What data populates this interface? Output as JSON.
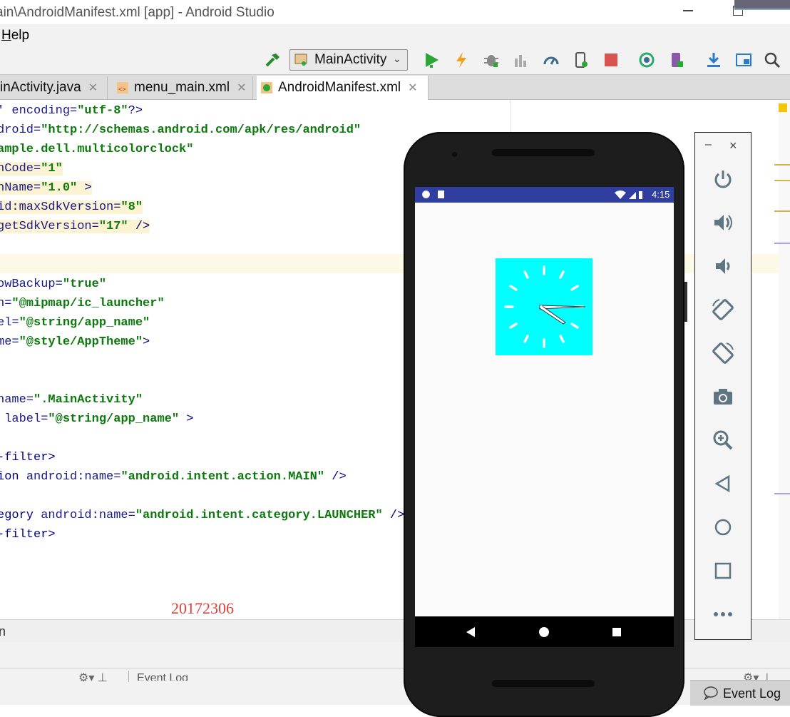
{
  "window": {
    "title": "ain\\AndroidManifest.xml [app] - Android Studio"
  },
  "menu": {
    "help": "Help"
  },
  "toolbar": {
    "run_config": "MainActivity",
    "icons": [
      "hammer-icon",
      "run-icon",
      "apply-changes-icon",
      "debug-icon",
      "profile-icon",
      "attach-debugger-icon",
      "device-file-icon",
      "stop-icon",
      "sync-icon",
      "avd-manager-icon",
      "sdk-manager-icon",
      "project-structure-icon",
      "search-icon"
    ]
  },
  "tabs": [
    {
      "label": "inActivity.java"
    },
    {
      "label": "menu_main.xml"
    },
    {
      "label": "AndroidManifest.xml"
    }
  ],
  "code": [
    {
      "parts": [
        [
          "attr",
          "' encoding="
        ],
        [
          "str",
          "\"utf-8\""
        ],
        [
          "tag",
          "?>"
        ]
      ]
    },
    {
      "parts": [
        [
          "attr",
          "droid="
        ],
        [
          "str",
          "\"http://schemas.android.com/apk/res/android\""
        ]
      ]
    },
    {
      "parts": [
        [
          "str",
          "ample.dell.multicolorclock\""
        ]
      ]
    },
    {
      "parts": [
        [
          "attr",
          "nCode="
        ],
        [
          "str",
          "\"1\""
        ]
      ],
      "hl": true
    },
    {
      "parts": [
        [
          "attr",
          "nName="
        ],
        [
          "str",
          "\"1.0\""
        ],
        [
          "tag",
          " >"
        ]
      ],
      "hl": true
    },
    {
      "parts": [
        [
          "attr",
          "id:maxSdkVersion="
        ],
        [
          "str",
          "\"8\""
        ]
      ],
      "hl": true
    },
    {
      "parts": [
        [
          "attr",
          "getSdkVersion="
        ],
        [
          "str",
          "\"17\""
        ],
        [
          "tag",
          " />"
        ]
      ],
      "hl": true
    },
    {
      "parts": [
        [
          "tag",
          ""
        ]
      ]
    },
    {
      "parts": [
        [
          "tag",
          ""
        ]
      ]
    },
    {
      "parts": [
        [
          "attr",
          "owBackup="
        ],
        [
          "str",
          "\"true\""
        ]
      ]
    },
    {
      "parts": [
        [
          "attr",
          "n="
        ],
        [
          "str",
          "\"@mipmap/ic_launcher\""
        ]
      ]
    },
    {
      "parts": [
        [
          "attr",
          "el="
        ],
        [
          "str",
          "\"@string/app_name\""
        ]
      ]
    },
    {
      "parts": [
        [
          "attr",
          "me="
        ],
        [
          "str",
          "\"@style/AppTheme\""
        ],
        [
          "tag",
          ">"
        ]
      ]
    },
    {
      "parts": [
        [
          "tag",
          ""
        ]
      ]
    },
    {
      "parts": [
        [
          "tag",
          ""
        ]
      ]
    },
    {
      "parts": [
        [
          "attr",
          "name="
        ],
        [
          "str",
          "\".MainActivity\""
        ]
      ]
    },
    {
      "parts": [
        [
          "attr",
          " label="
        ],
        [
          "str",
          "\"@string/app_name\""
        ],
        [
          "tag",
          " >"
        ]
      ]
    },
    {
      "parts": [
        [
          "tag",
          ""
        ]
      ]
    },
    {
      "parts": [
        [
          "tag",
          "-filter>"
        ]
      ]
    },
    {
      "parts": [
        [
          "tag",
          "ion "
        ],
        [
          "attr",
          "android:name="
        ],
        [
          "str",
          "\"android.intent.action.MAIN\""
        ],
        [
          "tag",
          " />"
        ]
      ]
    },
    {
      "parts": [
        [
          "tag",
          ""
        ]
      ]
    },
    {
      "parts": [
        [
          "tag",
          "egory "
        ],
        [
          "attr",
          "android:name="
        ],
        [
          "str",
          "\"android.intent.category.LAUNCHER\""
        ],
        [
          "tag",
          " />"
        ]
      ]
    },
    {
      "parts": [
        [
          "tag",
          "-filter>"
        ]
      ]
    }
  ],
  "watermark": "20172306",
  "status": {
    "structure_text": "n",
    "bottom_text": "Event Log",
    "event_log": "Event Log"
  },
  "emulator": {
    "statusbar_time": "4:15",
    "controls": [
      "power-icon",
      "volume-up-icon",
      "volume-down-icon",
      "rotate-left-icon",
      "rotate-right-icon",
      "screenshot-icon",
      "zoom-icon",
      "back-icon",
      "home-icon",
      "overview-icon",
      "more-icon"
    ],
    "window_buttons": [
      "–",
      "×"
    ]
  },
  "colors": {
    "accent_green": "#2aa834",
    "stop_red": "#d9534f",
    "clock_bg": "#00ffff",
    "statusbar": "#303f9f",
    "watermark": "#e0403a"
  }
}
